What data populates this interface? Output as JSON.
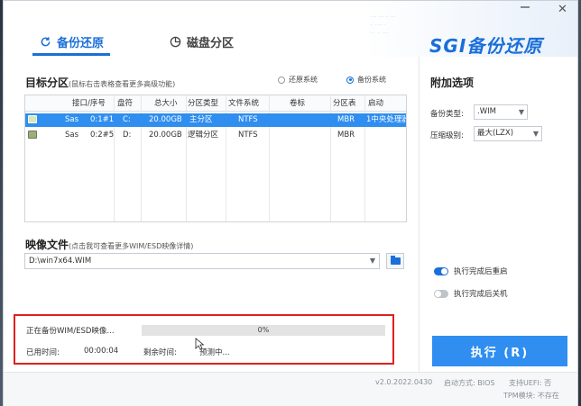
{
  "tabs": [
    {
      "label": "备份还原",
      "active": true,
      "icon": "refresh-icon"
    },
    {
      "label": "磁盘分区",
      "active": false,
      "icon": "pie-chart-icon"
    }
  ],
  "logo": "SGI备份还原",
  "target": {
    "title": "目标分区",
    "subtitle": "(鼠标右击表格查看更多高级功能)",
    "radio_restore": "还原系统",
    "radio_backup": "备份系统",
    "selected_mode": "backup"
  },
  "table": {
    "headers": [
      "接口/序号",
      "盘符",
      "总大小",
      "分区类型",
      "文件系统",
      "卷标",
      "分区表",
      "启动"
    ],
    "rows": [
      {
        "iface": "Sas",
        "index": "0:1#1",
        "drive": "C:",
        "size": "20.00GB",
        "ptype": "主分区",
        "fs": "NTFS",
        "label": "",
        "table": "MBR",
        "boot": "1中央处理器",
        "selected": true
      },
      {
        "iface": "Sas",
        "index": "0:2#5",
        "drive": "D:",
        "size": "20.00GB",
        "ptype": "逻辑分区",
        "fs": "NTFS",
        "label": "",
        "table": "MBR",
        "boot": "",
        "selected": false
      }
    ]
  },
  "image_file": {
    "title": "映像文件",
    "subtitle": "(点击我可查看更多WIM/ESD映像详情)",
    "path": "D:\\win7x64.WIM"
  },
  "status": {
    "task": "正在备份WIM/ESD映像...",
    "progress_pct": 0,
    "progress_label": "0%",
    "elapsed_label": "已用时间:",
    "elapsed_value": "00:00:04",
    "remaining_label": "剩余时间:",
    "remaining_value": "预测中..."
  },
  "options": {
    "title": "附加选项",
    "backup_type_label": "备份类型:",
    "backup_type_value": ".WIM",
    "compression_label": "压缩级别:",
    "compression_value": "最大(LZX)",
    "toggle_restart": {
      "label": "执行完成后重启",
      "on": true
    },
    "toggle_shutdown": {
      "label": "执行完成后关机",
      "on": false
    }
  },
  "execute_label": "执行 (R)",
  "footer": {
    "version": "v2.0.2022.0430",
    "boot_mode": "启动方式: BIOS",
    "uefi": "支持UEFI: 否",
    "tpm": "TPM模块: 不存在"
  },
  "colors": {
    "accent": "#1a6fd8",
    "selected_row": "#2f8ef0",
    "highlight_box": "#e02020"
  }
}
